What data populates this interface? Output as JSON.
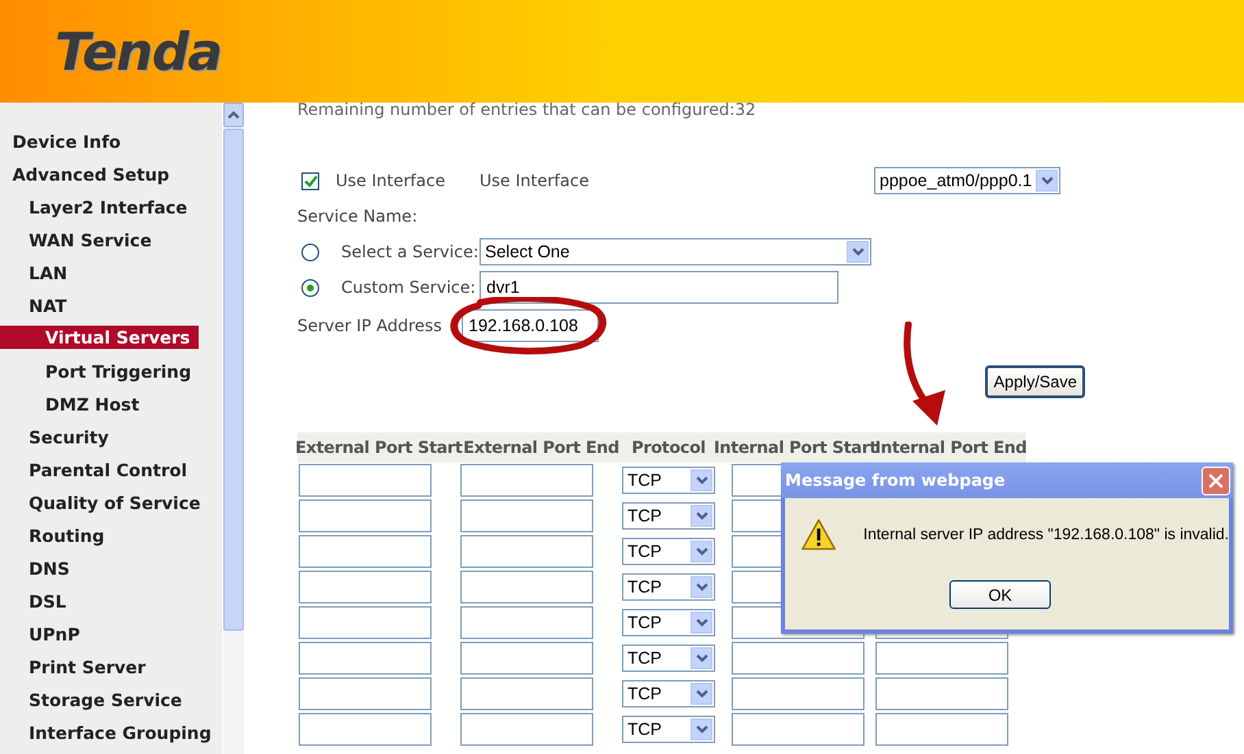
{
  "header": {
    "logo": "Tenda"
  },
  "sidebar": {
    "items": [
      {
        "label": "Device Info",
        "selected": false
      },
      {
        "label": "Advanced Setup",
        "selected": false,
        "children": [
          {
            "label": "Layer2 Interface",
            "selected": false
          },
          {
            "label": "WAN Service",
            "selected": false
          },
          {
            "label": "LAN",
            "selected": false
          },
          {
            "label": "NAT",
            "selected": false,
            "children": [
              {
                "label": "Virtual Servers",
                "selected": true
              },
              {
                "label": "Port Triggering",
                "selected": false
              },
              {
                "label": "DMZ Host",
                "selected": false
              }
            ]
          },
          {
            "label": "Security",
            "selected": false
          },
          {
            "label": "Parental Control",
            "selected": false
          },
          {
            "label": "Quality of Service",
            "selected": false
          },
          {
            "label": "Routing",
            "selected": false
          },
          {
            "label": "DNS",
            "selected": false
          },
          {
            "label": "DSL",
            "selected": false
          },
          {
            "label": "UPnP",
            "selected": false
          },
          {
            "label": "Print Server",
            "selected": false
          },
          {
            "label": "Storage Service",
            "selected": false
          },
          {
            "label": "Interface Grouping",
            "selected": false
          }
        ]
      }
    ]
  },
  "form": {
    "remaining": "Remaining number of entries that can be configured:32",
    "use_interface": {
      "checked": true,
      "label": "Use Interface",
      "label_2": "Use Interface",
      "value": "pppoe_atm0/ppp0.1"
    },
    "service_name_label": "Service Name:",
    "service_options": [
      {
        "kind": "select",
        "label": "Select a Service:",
        "selected": false,
        "value": "Select One"
      },
      {
        "kind": "text",
        "label": "Custom Service:",
        "selected": true,
        "value": "dvr1"
      }
    ],
    "server_ip": {
      "label": "Server IP Address",
      "value": "192.168.0.108"
    },
    "apply_button": "Apply/Save"
  },
  "table": {
    "columns": [
      "External Port Start",
      "External Port End",
      "Protocol",
      "Internal Port Start",
      "Internal Port End"
    ],
    "rows": [
      {
        "protocol": "TCP"
      },
      {
        "protocol": "TCP"
      },
      {
        "protocol": "TCP"
      },
      {
        "protocol": "TCP"
      },
      {
        "protocol": "TCP"
      },
      {
        "protocol": "TCP"
      },
      {
        "protocol": "TCP"
      },
      {
        "protocol": "TCP"
      }
    ]
  },
  "dialog": {
    "title": "Message from webpage",
    "message": "Internal server IP address \"192.168.0.108\" is invalid.",
    "button": "OK"
  }
}
